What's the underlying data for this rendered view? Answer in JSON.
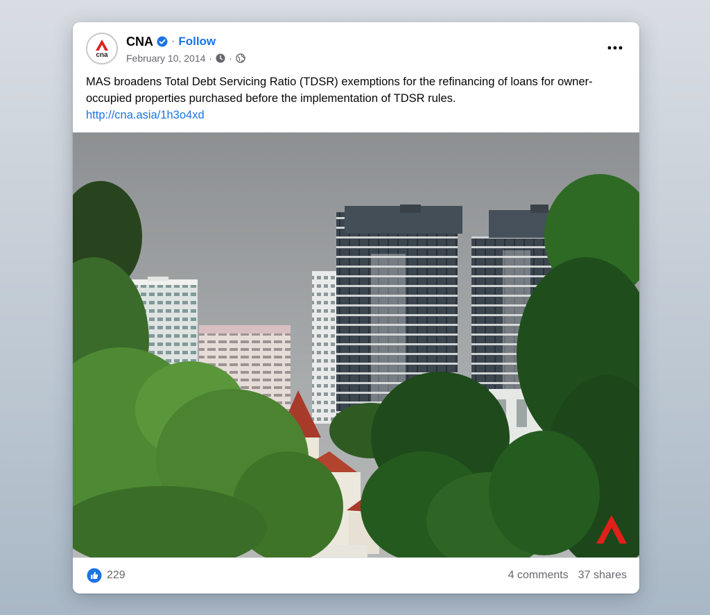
{
  "post": {
    "page_name": "CNA",
    "separator": "·",
    "follow_label": "Follow",
    "date": "February 10, 2014",
    "caption": "MAS broadens Total Debt Servicing Ratio (TDSR) exemptions for the refinancing of loans for owner-occupied properties purchased before the implementation of TDSR rules.",
    "link": "http://cna.asia/1h3o4xd",
    "avatar_text": "cna"
  },
  "footer": {
    "reaction_count": "229",
    "comments": "4 comments",
    "shares": "37 shares"
  },
  "icons": {
    "verified": "verified-badge-icon",
    "clock": "clock-icon",
    "globe": "globe-icon",
    "more": "more-options-icon",
    "like": "like-icon",
    "watermark": "cna-logo-icon"
  },
  "colors": {
    "brand_red": "#e0201a",
    "link_blue": "#1b74e4",
    "secondary_text": "#65676b"
  }
}
